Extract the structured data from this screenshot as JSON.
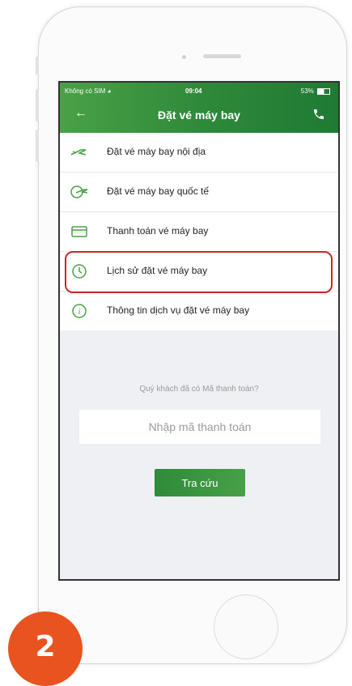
{
  "status_bar": {
    "carrier": "Không có SIM",
    "time": "09:04",
    "battery": "53%"
  },
  "header": {
    "title": "Đặt vé máy bay",
    "back_icon": "arrow-left-icon",
    "call_icon": "phone-icon"
  },
  "menu": {
    "items": [
      {
        "label": "Đặt vé máy bay nội địa",
        "icon": "plane-icon"
      },
      {
        "label": "Đặt vé máy bay quốc tế",
        "icon": "globe-plane-icon"
      },
      {
        "label": "Thanh toán vé máy bay",
        "icon": "card-icon"
      },
      {
        "label": "Lịch sử đặt vé máy bay",
        "icon": "history-icon"
      },
      {
        "label": "Thông tin dịch vụ đặt vé máy bay",
        "icon": "info-icon"
      }
    ]
  },
  "lookup": {
    "question": "Quý khách đã có Mã thanh toán?",
    "placeholder": "Nhập mã thanh toán",
    "button_label": "Tra cứu"
  },
  "step_badge": "2",
  "colors": {
    "brand_green": "#2f8a3a",
    "highlight_red": "#c62828",
    "badge_orange": "#e8531f"
  }
}
